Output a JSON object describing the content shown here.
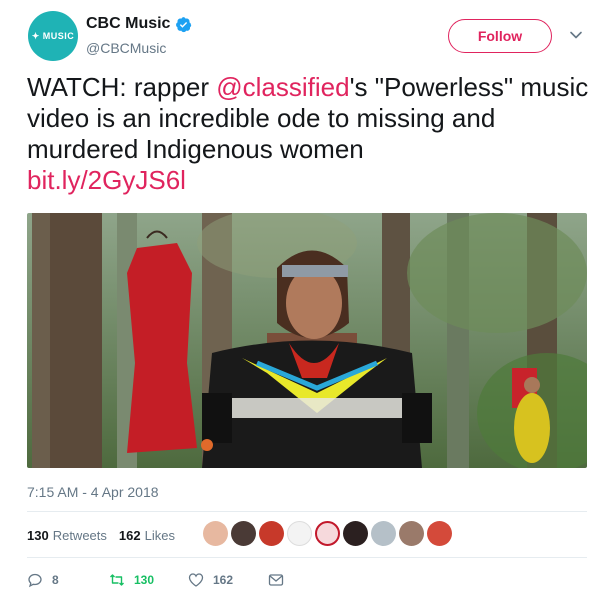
{
  "account": {
    "display_name": "CBC Music",
    "handle": "@CBCMusic",
    "avatar_text": "MUSIC",
    "verified": true,
    "follow_label": "Follow"
  },
  "tweet": {
    "text_prefix": "WATCH: rapper ",
    "mention": "@classified",
    "text_middle": "'s \"Powerless\" music video is an incredible ode to missing and murdered Indigenous women",
    "link": "bit.ly/2GyJS6l",
    "timestamp": "7:15 AM - 4 Apr 2018"
  },
  "stats": {
    "retweets_count": "130",
    "retweets_label": "Retweets",
    "likes_count": "162",
    "likes_label": "Likes"
  },
  "actions": {
    "reply_count": "8",
    "retweet_count": "130",
    "like_count": "162"
  },
  "colors": {
    "accent": "#e0245e",
    "brand_teal": "#1fb3b5",
    "retweet_green": "#17bf63",
    "muted": "#657786"
  },
  "icons": [
    "verified-icon",
    "chevron-down-icon",
    "reply-icon",
    "retweet-icon",
    "like-icon",
    "message-icon"
  ]
}
